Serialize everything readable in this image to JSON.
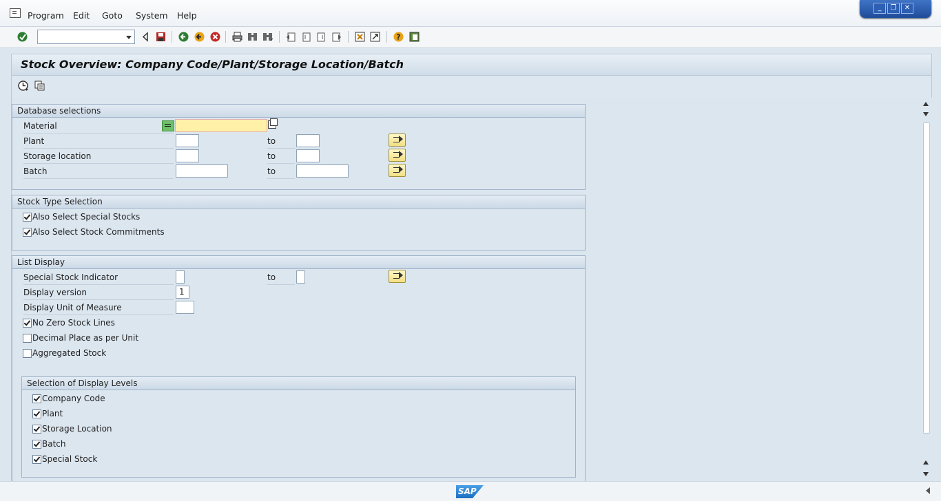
{
  "menu": {
    "program": "Program",
    "edit": "Edit",
    "goto": "Goto",
    "system": "System",
    "help": "Help"
  },
  "window": {
    "minimize": "_",
    "restore": "❐",
    "close": "✕"
  },
  "title": "Stock Overview: Company Code/Plant/Storage Location/Batch",
  "database_selections": {
    "header": "Database selections",
    "material_label": "Material",
    "plant_label": "Plant",
    "storage_label": "Storage location",
    "batch_label": "Batch",
    "to": "to"
  },
  "stock_type": {
    "header": "Stock Type Selection",
    "special_stocks": "Also Select Special Stocks",
    "commitments": "Also Select Stock Commitments"
  },
  "list_display": {
    "header": "List Display",
    "special_stock_indicator": "Special Stock Indicator",
    "display_version": "Display version",
    "display_version_value": "1",
    "display_uom": "Display Unit of Measure",
    "no_zero": "No Zero Stock Lines",
    "decimal": "Decimal Place as per Unit",
    "aggregated": "Aggregated Stock",
    "to": "to"
  },
  "display_levels": {
    "header": "Selection of Display Levels",
    "company_code": "Company Code",
    "plant": "Plant",
    "storage_location": "Storage Location",
    "batch": "Batch",
    "special_stock": "Special Stock"
  },
  "status": {
    "logo": "SAP"
  }
}
